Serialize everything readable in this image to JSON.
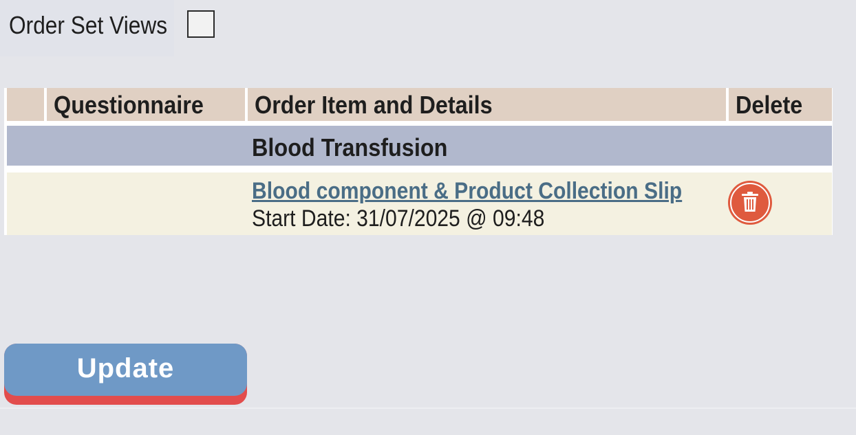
{
  "order_set_views": {
    "label": "Order Set Views",
    "checked": false
  },
  "table": {
    "headers": [
      "",
      "Questionnaire",
      "Order Item and Details",
      "Delete"
    ],
    "group_title": "Blood Transfusion",
    "items": [
      {
        "name": "Blood component & Product Collection Slip",
        "detail": "Start Date: 31/07/2025 @ 09:48",
        "delete_icon": "trash-icon"
      }
    ]
  },
  "actions": {
    "update_label": "Update"
  },
  "colors": {
    "header_bg": "#e0d0c3",
    "group_bg": "#b1b8cd",
    "item_bg": "#f4f1e1",
    "link": "#4a6d86",
    "delete": "#df5a3e",
    "update_face": "#6f99c6",
    "update_shadow": "#e24d4d"
  }
}
